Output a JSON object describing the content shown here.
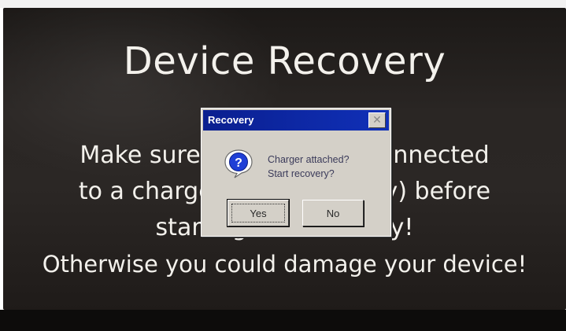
{
  "screen": {
    "title": "Device Recovery",
    "lines": [
      "Make sure the device is connected",
      "to a charger (power supply) before",
      "starting the recovery!",
      "Otherwise you could damage your device!"
    ]
  },
  "dialog": {
    "title": "Recovery",
    "close_icon": "close-icon",
    "icon": "question-icon",
    "message_line1": "Charger attached?",
    "message_line2": "Start recovery?",
    "yes_label": "Yes",
    "no_label": "No"
  },
  "colors": {
    "screen_background": "#2a2624",
    "text": "#f3f1ec",
    "titlebar": "#0a1f8f",
    "dialog_face": "#d4d0c8"
  }
}
